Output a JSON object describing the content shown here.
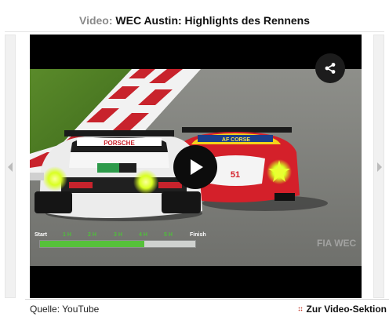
{
  "header": {
    "prefix": "Video:",
    "title": "WEC Austin: Highlights des Rennens"
  },
  "player": {
    "share_icon": "share-icon",
    "play_icon": "play-icon",
    "progress": {
      "labels": [
        "Start",
        "1 H",
        "2 H",
        "3 H",
        "4 H",
        "5 H",
        "Finish"
      ],
      "fraction_complete": 0.67,
      "fill_color": "#56c13a",
      "track_color": "#cfd2cf"
    },
    "car_front_branding": "PORSCHE",
    "car_rear_branding": "AF CORSE",
    "car_number": "51",
    "broadcaster_watermark": "FIA WEC"
  },
  "footer": {
    "source": "Quelle: YouTube",
    "link_label": "Zur Video-Sektion",
    "link_icon": "grid-icon"
  },
  "colors": {
    "title_prefix": "#8a8a8a",
    "accent": "#c0392b"
  }
}
